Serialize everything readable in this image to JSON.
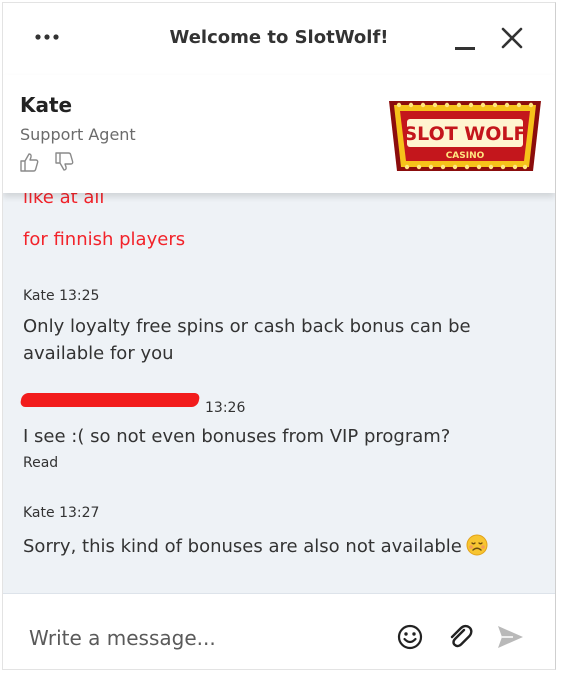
{
  "window": {
    "title": "Welcome to SlotWolf!"
  },
  "agent": {
    "name": "Kate",
    "role": "Support Agent"
  },
  "brand": {
    "logo_text": "SLOT WOLF",
    "logo_subtext": "CASINO"
  },
  "messages": [
    {
      "kind": "visitor-continued",
      "lines": [
        "like at all",
        "for finnish players"
      ]
    },
    {
      "kind": "agent",
      "author": "Kate",
      "time": "13:25",
      "text": "Only loyalty free spins or cash back bonus can be available for you"
    },
    {
      "kind": "visitor",
      "time": "13:26",
      "text": "I see :( so not even bonuses from VIP program?",
      "status": "Read"
    },
    {
      "kind": "agent",
      "author": "Kate",
      "time": "13:27",
      "text": "Sorry, this kind of bonuses are also not available",
      "emoji": "disappointed-face"
    }
  ],
  "composer": {
    "placeholder": "Write a message..."
  },
  "colors": {
    "visitor_text": "#f2232a",
    "messages_bg": "#eef2f6",
    "send_icon": "#b9b9b9"
  },
  "icons": [
    "more-dots-icon",
    "minimize-icon",
    "close-icon",
    "thumbs-up-icon",
    "thumbs-down-icon",
    "emoji-icon",
    "attach-icon",
    "send-icon"
  ]
}
